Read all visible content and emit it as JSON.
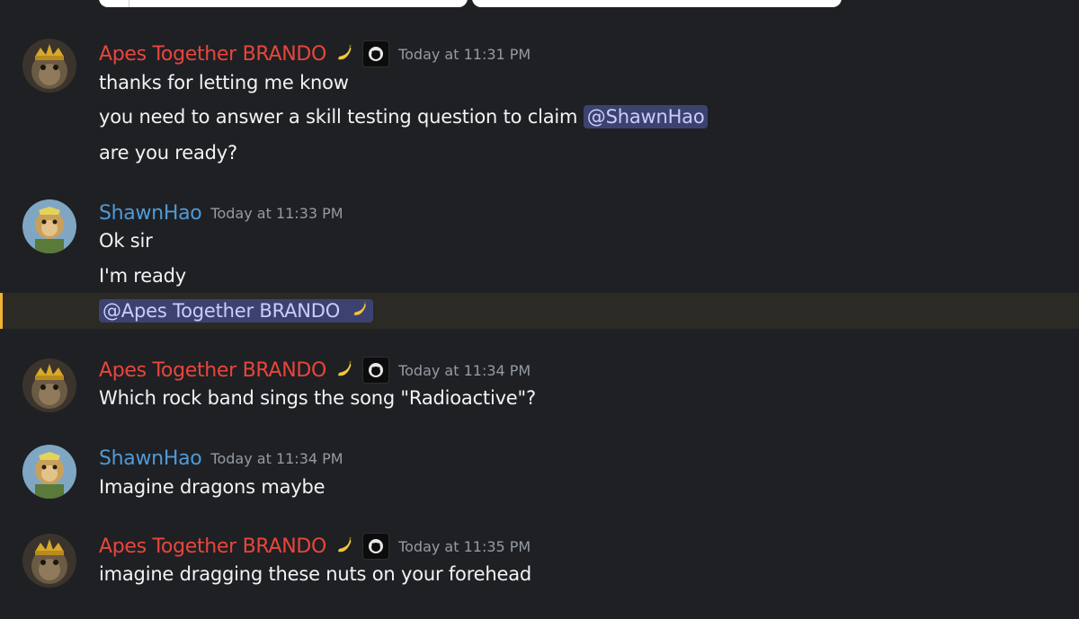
{
  "messages": [
    {
      "author": "Apes Together BRANDO",
      "timestamp": "Today at 11:31 PM",
      "lines": [
        "thanks for letting me know",
        "you need to answer a skill testing question to claim ",
        "are you ready?"
      ],
      "mention": "@ShawnHao"
    },
    {
      "author": "ShawnHao",
      "timestamp": "Today at 11:33 PM",
      "lines": [
        "Ok sir",
        "I'm ready"
      ],
      "mention": "@Apes Together BRANDO"
    },
    {
      "author": "Apes Together BRANDO",
      "timestamp": "Today at 11:34 PM",
      "lines": [
        "Which rock band sings the song \"Radioactive\"?"
      ]
    },
    {
      "author": "ShawnHao",
      "timestamp": "Today at 11:34 PM",
      "lines": [
        "Imagine dragons maybe"
      ]
    },
    {
      "author": "Apes Together BRANDO",
      "timestamp": "Today at 11:35 PM",
      "lines": [
        "imagine dragging these nuts on your forehead"
      ]
    }
  ],
  "colors": {
    "brando_name": "#e8463c",
    "shawn_name": "#4f9ad8",
    "mention_bg": "#3c4270",
    "highlight_bar": "#f0b232"
  },
  "icons": [
    "banana-emoji-icon",
    "ape-badge-icon"
  ]
}
